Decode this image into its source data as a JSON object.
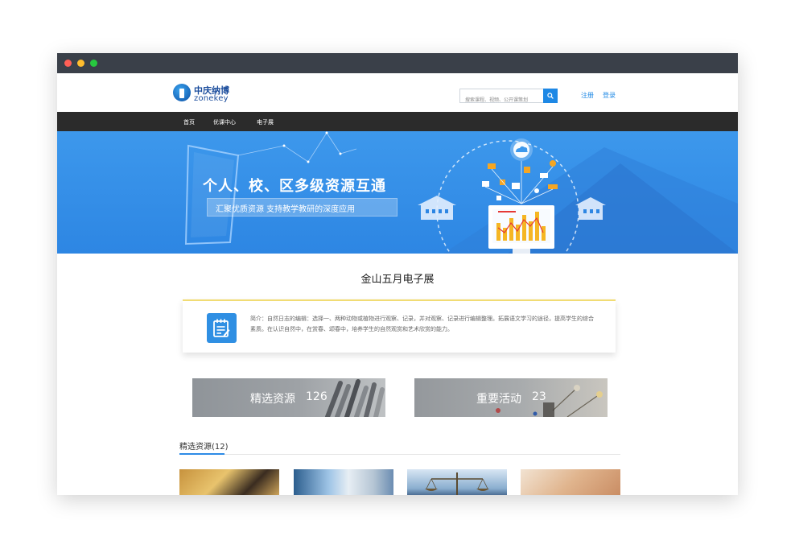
{
  "header": {
    "logo_cn": "中庆纳博",
    "logo_en": "zonekey",
    "search_placeholder": "搜索课程、视频、公开课策划",
    "register": "注册",
    "login": "登录"
  },
  "nav": {
    "items": [
      "首页",
      "优课中心",
      "电子展"
    ]
  },
  "banner": {
    "title": "个人、校、区多级资源互通",
    "subtitle": "汇聚优质资源 支持教学教研的深度应用"
  },
  "page": {
    "title": "金山五月电子展"
  },
  "intro": {
    "text": "简介：自然日志的编辑：选择一、两种动物或植物进行观察、记录，并对观察、记录进行编辑整理。拓展语文学习的途径，提高学生的综合素质。在认识自然中，在赏春、颂春中，培养学生的自然观赏和艺术欣赏的能力。"
  },
  "stats": [
    {
      "label": "精选资源",
      "count": "126"
    },
    {
      "label": "重要活动",
      "count": "23"
    }
  ],
  "section": {
    "title": "精选资源(12)"
  },
  "colors": {
    "accent": "#1e88e5",
    "nav_bg": "#2b2b2b",
    "banner_bg": "#2d86e3",
    "titlebar": "#3a4049"
  },
  "icons": [
    "search-icon",
    "notepad-icon",
    "cloud-icon",
    "monitor-chart-icon",
    "school-building-icon"
  ]
}
